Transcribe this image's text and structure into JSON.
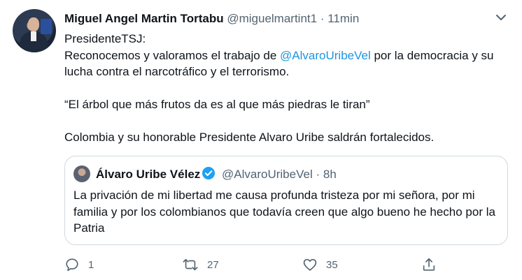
{
  "tweet": {
    "author_name": "Miguel Angel Martin Tortabu",
    "handle": "@miguelmartint1",
    "separator": "·",
    "time": "11min",
    "lines": {
      "line1": "PresidenteTSJ:",
      "line2_before": "Reconocemos y valoramos el trabajo de ",
      "line2_mention": "@AlvaroUribeVel",
      "line2_after": " por la democracia y su lucha contra el narcotráfico y el terrorismo.",
      "quote_line": "“El árbol que más frutos da es al que más piedras le tiran”",
      "closing": "Colombia y su honorable Presidente Alvaro Uribe saldrán fortalecidos."
    }
  },
  "quoted_tweet": {
    "author_name": "Álvaro Uribe Vélez",
    "handle": "@AlvaroUribeVel",
    "separator": "·",
    "time": "8h",
    "text": "La privación de mi libertad me causa profunda tristeza por mi señora, por mi familia y por los colombianos que todavía creen que algo bueno he hecho por la Patria"
  },
  "actions": {
    "reply_count": "1",
    "retweet_count": "27",
    "like_count": "35"
  },
  "icons": {
    "more": "chevron-down-icon",
    "reply": "reply-icon",
    "retweet": "retweet-icon",
    "like": "heart-icon",
    "share": "share-icon",
    "verified": "verified-badge-icon"
  },
  "colors": {
    "text": "#0f1419",
    "secondary": "#536471",
    "link": "#1b95e0",
    "verified": "#1da1f2",
    "border": "#cfd9de"
  }
}
